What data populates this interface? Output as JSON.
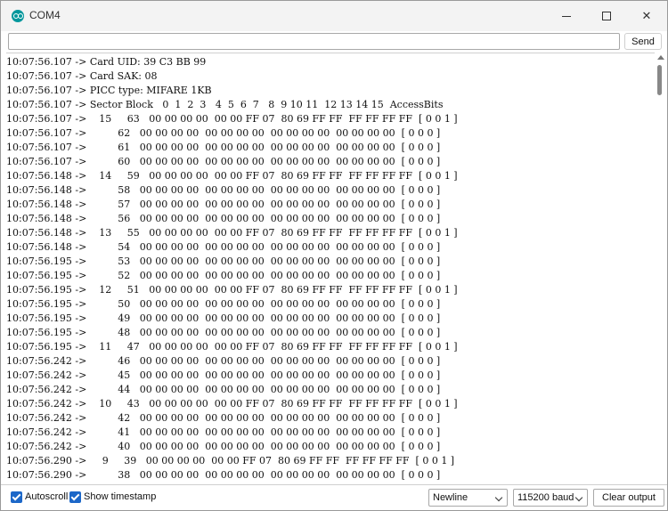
{
  "window": {
    "title": "COM4",
    "icon": "arduino-icon"
  },
  "send_bar": {
    "input_value": "",
    "send_label": "Send"
  },
  "output_lines": [
    "10:07:56.107 -> Card UID: 39 C3 BB 99",
    "10:07:56.107 -> Card SAK: 08",
    "10:07:56.107 -> PICC type: MIFARE 1KB",
    "10:07:56.107 -> Sector Block   0  1  2  3   4  5  6  7   8  9 10 11  12 13 14 15  AccessBits",
    "10:07:56.107 ->    15     63   00 00 00 00  00 00 FF 07  80 69 FF FF  FF FF FF FF  [ 0 0 1 ]",
    "10:07:56.107 ->          62   00 00 00 00  00 00 00 00  00 00 00 00  00 00 00 00  [ 0 0 0 ]",
    "10:07:56.107 ->          61   00 00 00 00  00 00 00 00  00 00 00 00  00 00 00 00  [ 0 0 0 ]",
    "10:07:56.107 ->          60   00 00 00 00  00 00 00 00  00 00 00 00  00 00 00 00  [ 0 0 0 ]",
    "10:07:56.148 ->    14     59   00 00 00 00  00 00 FF 07  80 69 FF FF  FF FF FF FF  [ 0 0 1 ]",
    "10:07:56.148 ->          58   00 00 00 00  00 00 00 00  00 00 00 00  00 00 00 00  [ 0 0 0 ]",
    "10:07:56.148 ->          57   00 00 00 00  00 00 00 00  00 00 00 00  00 00 00 00  [ 0 0 0 ]",
    "10:07:56.148 ->          56   00 00 00 00  00 00 00 00  00 00 00 00  00 00 00 00  [ 0 0 0 ]",
    "10:07:56.148 ->    13     55   00 00 00 00  00 00 FF 07  80 69 FF FF  FF FF FF FF  [ 0 0 1 ]",
    "10:07:56.148 ->          54   00 00 00 00  00 00 00 00  00 00 00 00  00 00 00 00  [ 0 0 0 ]",
    "10:07:56.195 ->          53   00 00 00 00  00 00 00 00  00 00 00 00  00 00 00 00  [ 0 0 0 ]",
    "10:07:56.195 ->          52   00 00 00 00  00 00 00 00  00 00 00 00  00 00 00 00  [ 0 0 0 ]",
    "10:07:56.195 ->    12     51   00 00 00 00  00 00 FF 07  80 69 FF FF  FF FF FF FF  [ 0 0 1 ]",
    "10:07:56.195 ->          50   00 00 00 00  00 00 00 00  00 00 00 00  00 00 00 00  [ 0 0 0 ]",
    "10:07:56.195 ->          49   00 00 00 00  00 00 00 00  00 00 00 00  00 00 00 00  [ 0 0 0 ]",
    "10:07:56.195 ->          48   00 00 00 00  00 00 00 00  00 00 00 00  00 00 00 00  [ 0 0 0 ]",
    "10:07:56.195 ->    11     47   00 00 00 00  00 00 FF 07  80 69 FF FF  FF FF FF FF  [ 0 0 1 ]",
    "10:07:56.242 ->          46   00 00 00 00  00 00 00 00  00 00 00 00  00 00 00 00  [ 0 0 0 ]",
    "10:07:56.242 ->          45   00 00 00 00  00 00 00 00  00 00 00 00  00 00 00 00  [ 0 0 0 ]",
    "10:07:56.242 ->          44   00 00 00 00  00 00 00 00  00 00 00 00  00 00 00 00  [ 0 0 0 ]",
    "10:07:56.242 ->    10     43   00 00 00 00  00 00 FF 07  80 69 FF FF  FF FF FF FF  [ 0 0 1 ]",
    "10:07:56.242 ->          42   00 00 00 00  00 00 00 00  00 00 00 00  00 00 00 00  [ 0 0 0 ]",
    "10:07:56.242 ->          41   00 00 00 00  00 00 00 00  00 00 00 00  00 00 00 00  [ 0 0 0 ]",
    "10:07:56.242 ->          40   00 00 00 00  00 00 00 00  00 00 00 00  00 00 00 00  [ 0 0 0 ]",
    "10:07:56.290 ->     9     39   00 00 00 00  00 00 FF 07  80 69 FF FF  FF FF FF FF  [ 0 0 1 ]",
    "10:07:56.290 ->          38   00 00 00 00  00 00 00 00  00 00 00 00  00 00 00 00  [ 0 0 0 ]"
  ],
  "status_bar": {
    "autoscroll_label": "Autoscroll",
    "autoscroll_checked": true,
    "timestamp_label": "Show timestamp",
    "timestamp_checked": true,
    "line_ending": "Newline",
    "baud_rate": "115200 baud",
    "clear_label": "Clear output"
  },
  "colors": {
    "checkbox_accent": "#1c67c8",
    "app_icon": "#00979c"
  }
}
